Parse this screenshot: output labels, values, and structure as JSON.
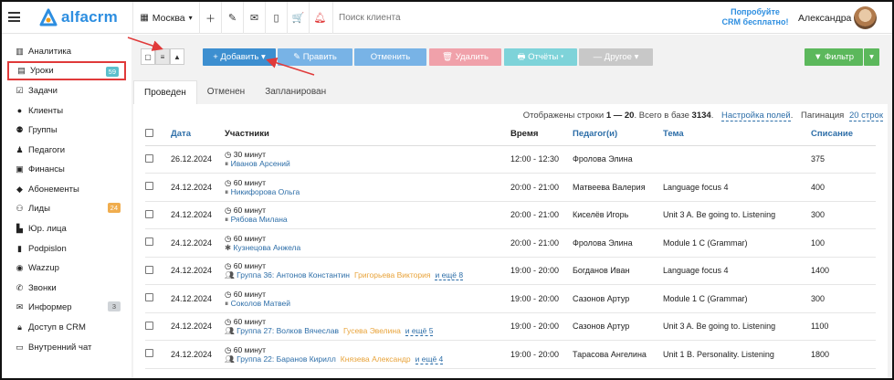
{
  "app": {
    "brand": "alfacrm",
    "city": "Москва",
    "search_placeholder": "Поиск клиента",
    "promo_line1": "Попробуйте",
    "promo_line2": "CRM бесплатно!",
    "username": "Александра",
    "colors": {
      "accent": "#2d8ee0",
      "danger": "#e03a3a",
      "success": "#5cb85c"
    }
  },
  "sidebar": {
    "items": [
      {
        "label": "Аналитика",
        "icon": "chart-icon",
        "badge": ""
      },
      {
        "label": "Уроки",
        "icon": "calendar-icon",
        "badge": "59"
      },
      {
        "label": "Задачи",
        "icon": "checklist-icon",
        "badge": ""
      },
      {
        "label": "Клиенты",
        "icon": "user-icon",
        "badge": ""
      },
      {
        "label": "Группы",
        "icon": "users-icon",
        "badge": ""
      },
      {
        "label": "Педагоги",
        "icon": "teacher-icon",
        "badge": ""
      },
      {
        "label": "Финансы",
        "icon": "money-icon",
        "badge": ""
      },
      {
        "label": "Абонементы",
        "icon": "tag-icon",
        "badge": ""
      },
      {
        "label": "Лиды",
        "icon": "user-plus-icon",
        "badge": "24"
      },
      {
        "label": "Юр. лица",
        "icon": "building-icon",
        "badge": ""
      },
      {
        "label": "Podpislon",
        "icon": "document-icon",
        "badge": ""
      },
      {
        "label": "Wazzup",
        "icon": "chat-icon",
        "badge": ""
      },
      {
        "label": "Звонки",
        "icon": "phone-icon",
        "badge": ""
      },
      {
        "label": "Информер",
        "icon": "envelope-icon",
        "badge": "3"
      },
      {
        "label": "Доступ в CRM",
        "icon": "lock-icon",
        "badge": ""
      },
      {
        "label": "Внутренний чат",
        "icon": "keyboard-icon",
        "badge": ""
      }
    ]
  },
  "toolbar": {
    "add": "+ Добавить ▾",
    "edit": "✎ Править",
    "cancel": "Отменить",
    "delete": "🗑 Удалить",
    "reports": "🖶 Отчёты ▾",
    "other": "— Другое ▾",
    "filter": "▼ Фильтр",
    "filter_caret": "▾"
  },
  "tabs": [
    "Проведен",
    "Отменен",
    "Запланирован"
  ],
  "summary": {
    "prefix": "Отображены строки ",
    "range": "1 — 20",
    "mid": ". Всего в базе ",
    "total": "3134",
    "end": ".",
    "settings_link": "Настройка полей",
    "pagination_label": "Пагинация",
    "pagination_link": "20 строк"
  },
  "table": {
    "headers": [
      "Дата",
      "Участники",
      "Время",
      "Педагог(и)",
      "Тема",
      "Списание"
    ],
    "rows": [
      {
        "date": "26.12.2024",
        "duration": "30 минут",
        "participant_icon": "pause",
        "participant": "Иванов Арсений",
        "other": "",
        "more": "",
        "time": "12:00 - 12:30",
        "teacher": "Фролова Элина",
        "topic": "",
        "charge": "375"
      },
      {
        "date": "24.12.2024",
        "duration": "60 минут",
        "participant_icon": "pause",
        "participant": "Никифорова Ольга",
        "other": "",
        "more": "",
        "time": "20:00 - 21:00",
        "teacher": "Матвеева Валерия",
        "topic": "Language focus 4",
        "charge": "400"
      },
      {
        "date": "24.12.2024",
        "duration": "60 минут",
        "participant_icon": "pause",
        "participant": "Рябова Милана",
        "other": "",
        "more": "",
        "time": "20:00 - 21:00",
        "teacher": "Киселёв Игорь",
        "topic": "Unit 3 A. Be going to. Listening",
        "charge": "300"
      },
      {
        "date": "24.12.2024",
        "duration": "60 минут",
        "participant_icon": "star",
        "participant": "Кузнецова Анжела",
        "other": "",
        "more": "",
        "time": "20:00 - 21:00",
        "teacher": "Фролова Элина",
        "topic": "Module 1 C (Grammar)",
        "charge": "100"
      },
      {
        "date": "24.12.2024",
        "duration": "60 минут",
        "participant_icon": "group",
        "participant": "Группа 36: Антонов Константин",
        "other": "Григорьева Виктория",
        "more": "и ещё 8",
        "time": "19:00 - 20:00",
        "teacher": "Богданов Иван",
        "topic": "Language focus 4",
        "charge": "1400"
      },
      {
        "date": "24.12.2024",
        "duration": "60 минут",
        "participant_icon": "pause",
        "participant": "Соколов Матвей",
        "other": "",
        "more": "",
        "time": "19:00 - 20:00",
        "teacher": "Сазонов Артур",
        "topic": "Module 1 C (Grammar)",
        "charge": "300"
      },
      {
        "date": "24.12.2024",
        "duration": "60 минут",
        "participant_icon": "group",
        "participant": "Группа 27: Волков Вячеслав",
        "other": "Гусева Эвелина",
        "more": "и ещё 5",
        "time": "19:00 - 20:00",
        "teacher": "Сазонов Артур",
        "topic": "Unit 3 A. Be going to. Listening",
        "charge": "1100"
      },
      {
        "date": "24.12.2024",
        "duration": "60 минут",
        "participant_icon": "group",
        "participant": "Группа 22: Баранов Кирилл",
        "other": "Князева Александр",
        "more": "и ещё 4",
        "time": "19:00 - 20:00",
        "teacher": "Тарасова Ангелина",
        "topic": "Unit 1 B. Personality. Listening",
        "charge": "1800"
      }
    ]
  }
}
